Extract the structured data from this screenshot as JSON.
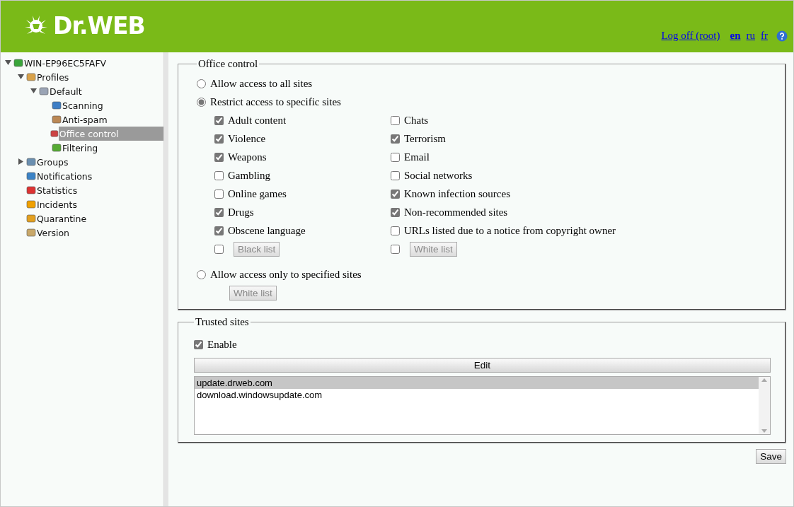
{
  "header": {
    "logo": "Dr.WEB",
    "logoff_link": "Log off (root)",
    "languages": [
      {
        "label": "en",
        "selected": true
      },
      {
        "label": "ru",
        "selected": false
      },
      {
        "label": "fr",
        "selected": false
      }
    ]
  },
  "sidebar": {
    "tree": [
      {
        "label": "WIN-EP96EC5FAFV",
        "expanded": true,
        "selected": false,
        "children": [
          {
            "label": "Profiles",
            "expanded": true,
            "selected": false,
            "children": [
              {
                "label": "Default",
                "expanded": true,
                "selected": false,
                "children": [
                  {
                    "label": "Scanning",
                    "selected": false
                  },
                  {
                    "label": "Anti-spam",
                    "selected": false
                  },
                  {
                    "label": "Office control",
                    "selected": true
                  },
                  {
                    "label": "Filtering",
                    "selected": false
                  }
                ]
              }
            ]
          },
          {
            "label": "Groups",
            "expanded": false,
            "selected": false
          },
          {
            "label": "Notifications",
            "selected": false
          },
          {
            "label": "Statistics",
            "selected": false
          },
          {
            "label": "Incidents",
            "selected": false
          },
          {
            "label": "Quarantine",
            "selected": false
          },
          {
            "label": "Version",
            "selected": false
          }
        ]
      }
    ]
  },
  "office_control": {
    "title": "Office control",
    "access_modes": [
      {
        "label": "Allow access to all sites",
        "selected": false
      },
      {
        "label": "Restrict access to specific sites",
        "selected": true
      },
      {
        "label": "Allow access only to specified sites",
        "selected": false
      }
    ],
    "categories_left": [
      {
        "label": "Adult content",
        "checked": true
      },
      {
        "label": "Violence",
        "checked": true
      },
      {
        "label": "Weapons",
        "checked": true
      },
      {
        "label": "Gambling",
        "checked": false
      },
      {
        "label": "Online games",
        "checked": false
      },
      {
        "label": "Drugs",
        "checked": true
      },
      {
        "label": "Obscene language",
        "checked": true
      }
    ],
    "categories_right": [
      {
        "label": "Chats",
        "checked": false
      },
      {
        "label": "Terrorism",
        "checked": true
      },
      {
        "label": "Email",
        "checked": false
      },
      {
        "label": "Social networks",
        "checked": false
      },
      {
        "label": "Known infection sources",
        "checked": true
      },
      {
        "label": "Non-recommended sites",
        "checked": true
      },
      {
        "label": "URLs listed due to a notice from copyright owner",
        "checked": false
      }
    ],
    "black_list": {
      "label": "Black list",
      "checked": false
    },
    "white_list": {
      "label": "White list",
      "checked": false
    },
    "specified_white_list": {
      "label": "White list"
    }
  },
  "trusted_sites": {
    "title": "Trusted sites",
    "enable": {
      "label": "Enable",
      "checked": true
    },
    "edit_button": "Edit",
    "sites": [
      {
        "label": "update.drweb.com",
        "selected": true
      },
      {
        "label": "download.windowsupdate.com",
        "selected": false
      }
    ]
  },
  "save_button": "Save"
}
